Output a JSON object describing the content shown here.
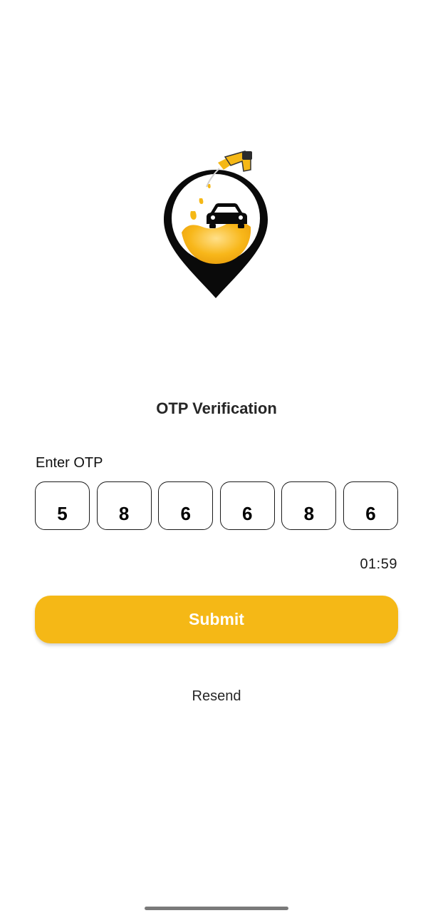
{
  "app": {
    "logo_icon": "fuel-pin-car-logo",
    "accent_color": "#f5b816"
  },
  "header": {
    "title": "OTP Verification"
  },
  "otp": {
    "label": "Enter OTP",
    "digits": [
      "5",
      "8",
      "6",
      "6",
      "8",
      "6"
    ],
    "timer": "01:59"
  },
  "actions": {
    "submit_label": "Submit",
    "resend_label": "Resend"
  }
}
